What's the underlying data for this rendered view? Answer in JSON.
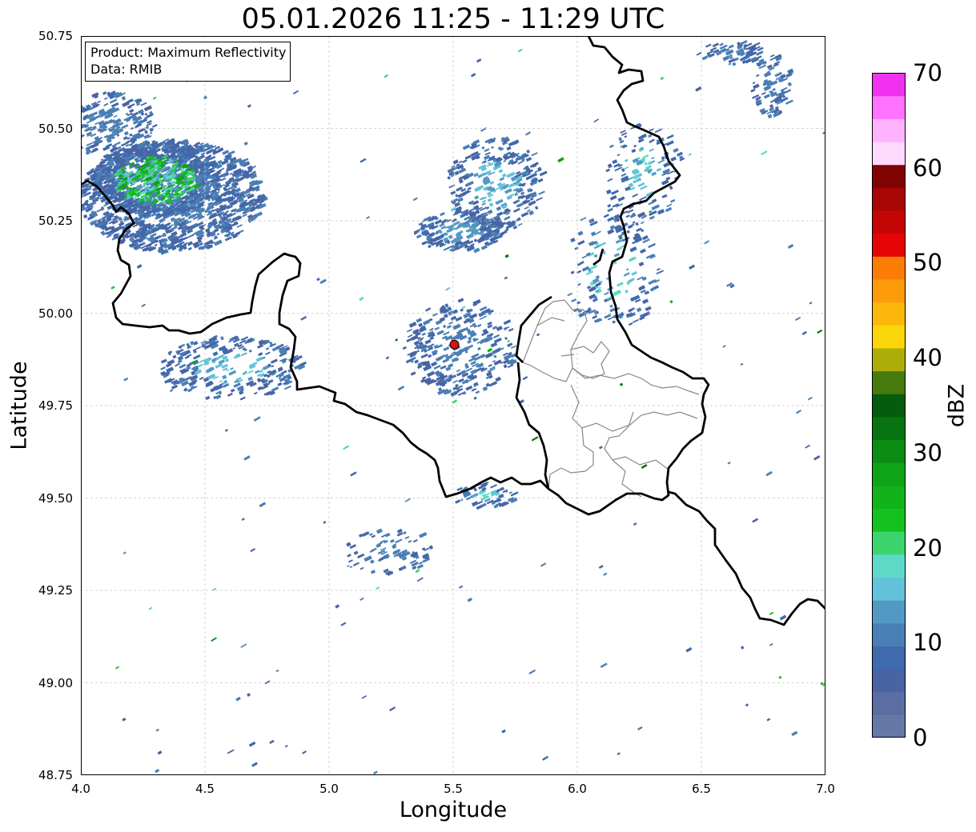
{
  "title": "05.01.2026 11:25 - 11:29 UTC",
  "info_box": {
    "product_line": "Product: Maximum Reflectivity",
    "data_line": "Data: RMIB"
  },
  "axes": {
    "xlabel": "Longitude",
    "ylabel": "Latitude",
    "xlim": [
      4.0,
      7.0
    ],
    "ylim": [
      48.75,
      50.75
    ],
    "x_ticks": [
      "4.0",
      "4.5",
      "5.0",
      "5.5",
      "6.0",
      "6.5",
      "7.0"
    ],
    "y_ticks": [
      "50.75",
      "50.50",
      "50.25",
      "50.00",
      "49.75",
      "49.50",
      "49.25",
      "49.00",
      "48.75"
    ],
    "grid": true
  },
  "colorbar": {
    "label": "dBZ",
    "range": [
      0,
      70
    ],
    "tick_labels": [
      "0",
      "10",
      "20",
      "30",
      "40",
      "50",
      "60",
      "70"
    ],
    "colors": [
      "#6679a6",
      "#5a6ea3",
      "#4a63a3",
      "#3f6aad",
      "#4a7fb5",
      "#5299c4",
      "#63c2d9",
      "#5fd9c7",
      "#3dd46e",
      "#14c21f",
      "#12b31a",
      "#0fa317",
      "#0b8c13",
      "#087310",
      "#055c0c",
      "#467a0d",
      "#adad0a",
      "#fad60a",
      "#fcb80a",
      "#fc9c0a",
      "#fc7d05",
      "#e60505",
      "#c40505",
      "#a80505",
      "#800303",
      "#ffdaff",
      "#ffb3ff",
      "#ff73ff",
      "#f032f0"
    ]
  },
  "radar_site": {
    "lon": 5.505,
    "lat": 49.915,
    "color": "#e01010"
  },
  "border_colors": {
    "country": "#000000",
    "province": "#888888"
  }
}
